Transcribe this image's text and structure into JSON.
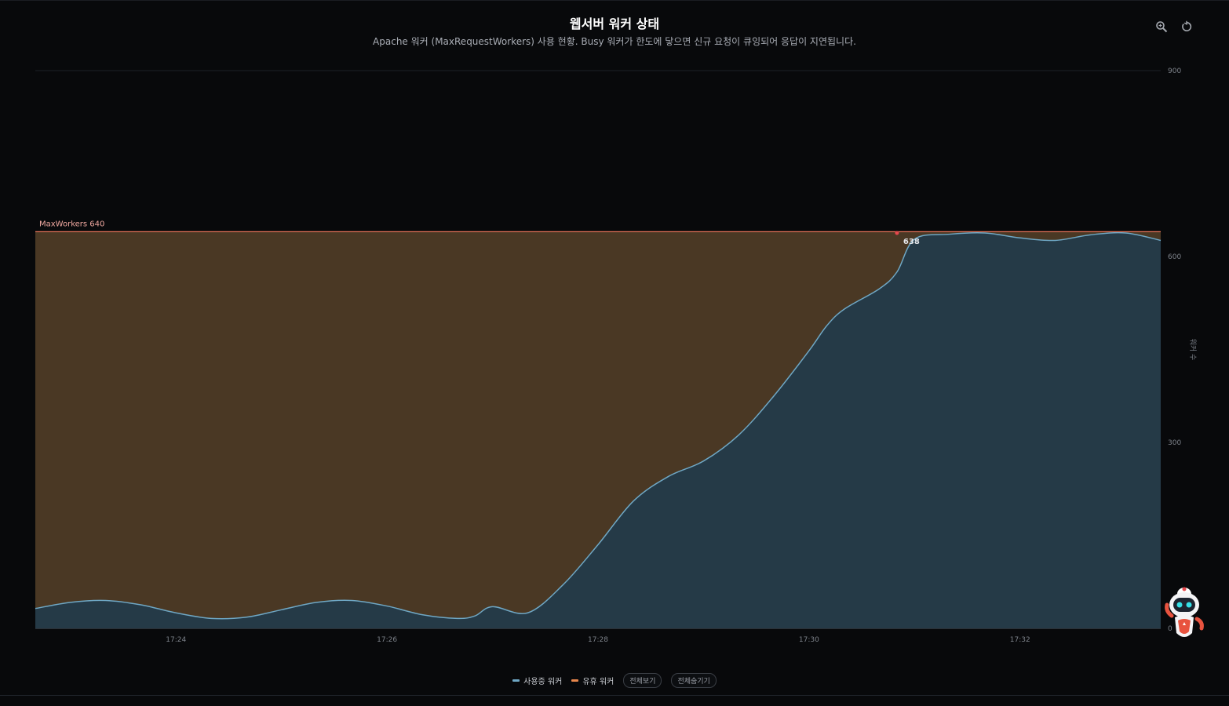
{
  "header": {
    "title": "웹서버 워커 상태",
    "subtitle": "Apache 워커 (MaxRequestWorkers) 사용 현황. Busy 워커가 한도에 닿으면 신규 요청이 큐잉되어 응답이 지연됩니다."
  },
  "toolbar": {
    "zoom_icon": "zoom-icon",
    "reset_icon": "reset-icon"
  },
  "legend": {
    "busy_label": "사용중 워커",
    "idle_label": "유휴 워커",
    "show_all": "전체보기",
    "hide_all": "전체숨기기"
  },
  "colors": {
    "busy_line": "#6fa7c4",
    "busy_fill": "#253a47",
    "idle_fill": "#4a3824",
    "idle_swatch": "#e8874c",
    "limit_line": "#e8745a",
    "limit_label": "#f0a8a0",
    "peak_marker": "#e5484d"
  },
  "chart_data": {
    "type": "area",
    "stacked": true,
    "title": "웹서버 워커 상태",
    "ylabel": "워커 수",
    "ylim": [
      0,
      900
    ],
    "yticks": [
      0,
      300,
      600,
      900
    ],
    "x_tick_labels": [
      "17:24",
      "17:26",
      "17:28",
      "17:30",
      "17:32"
    ],
    "xlim": [
      "17:22:40",
      "17:33:20"
    ],
    "grid": true,
    "legend_position": "bottom-center",
    "threshold": {
      "label": "MaxWorkers 640",
      "value": 640
    },
    "peak_annotation": {
      "x": "17:30:50",
      "value": 638,
      "label": "638"
    },
    "x": [
      "17:22:40",
      "17:23:00",
      "17:23:20",
      "17:23:40",
      "17:24:00",
      "17:24:20",
      "17:24:40",
      "17:25:00",
      "17:25:20",
      "17:25:40",
      "17:26:00",
      "17:26:20",
      "17:26:40",
      "17:26:50",
      "17:27:00",
      "17:27:20",
      "17:27:40",
      "17:28:00",
      "17:28:20",
      "17:28:40",
      "17:29:00",
      "17:29:20",
      "17:29:40",
      "17:30:00",
      "17:30:10",
      "17:30:20",
      "17:30:40",
      "17:30:50",
      "17:31:00",
      "17:31:20",
      "17:31:40",
      "17:32:00",
      "17:32:20",
      "17:32:40",
      "17:33:00",
      "17:33:20"
    ],
    "series": [
      {
        "name": "사용중 워커",
        "values": [
          32,
          42,
          45,
          38,
          25,
          16,
          18,
          30,
          42,
          45,
          36,
          22,
          16,
          20,
          35,
          25,
          70,
          135,
          205,
          245,
          270,
          312,
          375,
          448,
          488,
          515,
          548,
          575,
          628,
          636,
          638,
          630,
          626,
          635,
          638,
          626
        ]
      },
      {
        "name": "유휴 워커",
        "values": [
          608,
          598,
          595,
          602,
          615,
          624,
          622,
          610,
          598,
          595,
          604,
          618,
          624,
          620,
          605,
          615,
          570,
          505,
          435,
          395,
          370,
          328,
          265,
          192,
          152,
          125,
          92,
          65,
          12,
          4,
          2,
          10,
          14,
          5,
          2,
          14
        ]
      }
    ]
  }
}
